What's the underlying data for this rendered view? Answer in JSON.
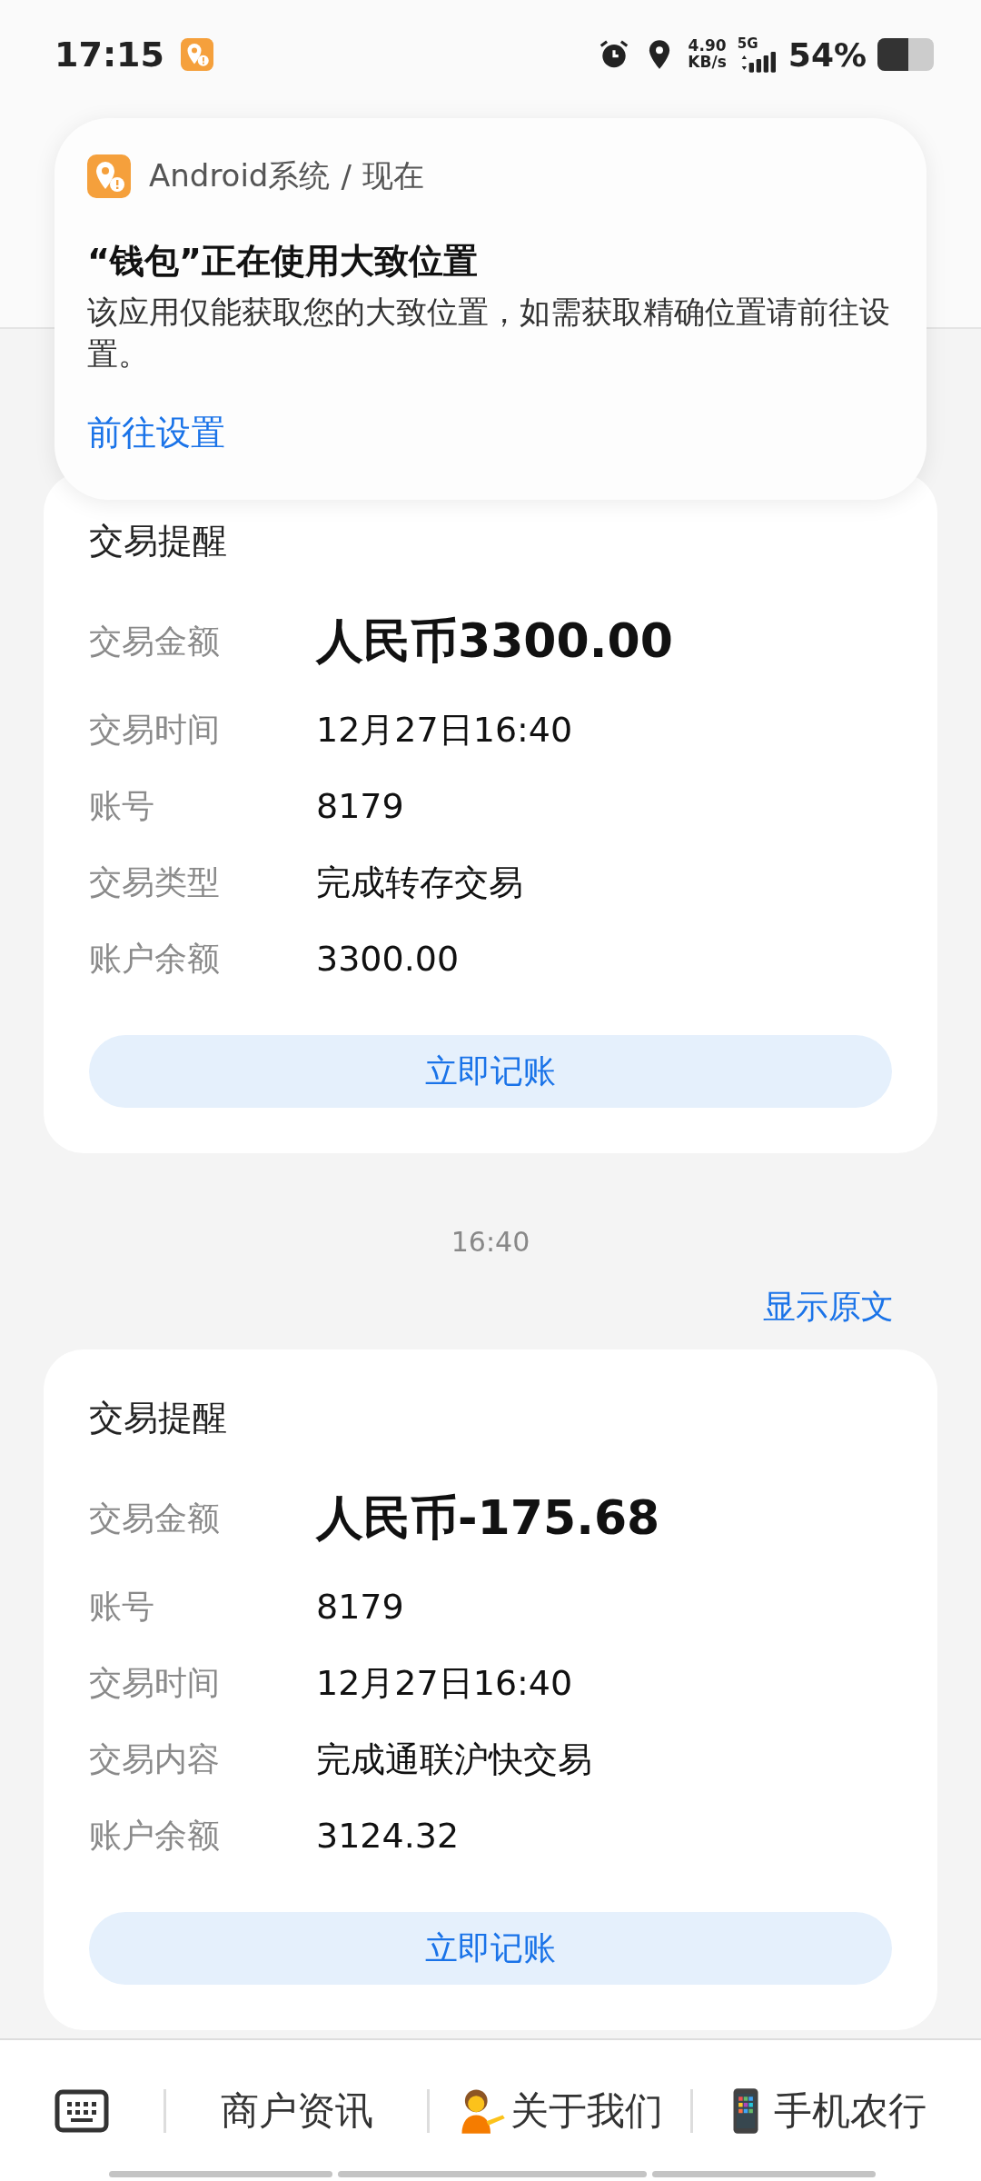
{
  "status_bar": {
    "time": "17:15",
    "net_speed": "4.90",
    "net_unit": "KB/s",
    "network": "5G",
    "battery": "54%"
  },
  "notification": {
    "app": "Android系统",
    "separator": "/",
    "time": "现在",
    "title": "“钱包”正在使用大致位置",
    "body": "该应用仅能获取您的大致位置，如需获取精确位置请前往设置。",
    "action": "前往设置"
  },
  "messages": [
    {
      "title": "交易提醒",
      "fields": [
        {
          "label": "交易金额",
          "value": "人民币3300.00",
          "kind": "amount"
        },
        {
          "label": "交易时间",
          "value": "12月27日16:40",
          "kind": "plain"
        },
        {
          "label": "账号",
          "value": "8179",
          "kind": "plain"
        },
        {
          "label": "交易类型",
          "value": "完成转存交易",
          "kind": "plain"
        },
        {
          "label": "账户余额",
          "value": "3300.00",
          "kind": "plain"
        }
      ],
      "button": "立即记账"
    },
    {
      "time": "16:40",
      "show_original": "显示原文",
      "title": "交易提醒",
      "fields": [
        {
          "label": "交易金额",
          "value": "人民币-175.68",
          "kind": "amount"
        },
        {
          "label": "账号",
          "value": "8179",
          "kind": "plain"
        },
        {
          "label": "交易时间",
          "value": "12月27日16:40",
          "kind": "plain"
        },
        {
          "label": "交易内容",
          "value": "完成通联沪快交易",
          "kind": "plain"
        },
        {
          "label": "账户余额",
          "value": "3124.32",
          "kind": "plain"
        }
      ],
      "button": "立即记账"
    }
  ],
  "bottom_bar": [
    {
      "kind": "keyboard"
    },
    {
      "kind": "text",
      "label": "商户资讯"
    },
    {
      "kind": "person",
      "label": "关于我们"
    },
    {
      "kind": "phone",
      "label": "手机农行"
    }
  ]
}
